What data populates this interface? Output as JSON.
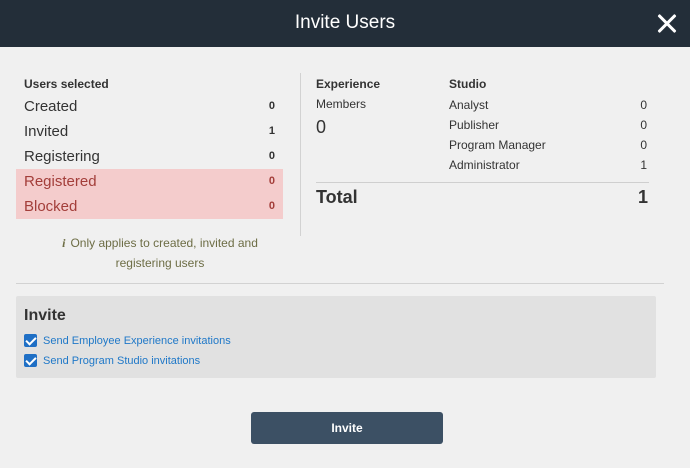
{
  "dialog": {
    "title": "Invite Users",
    "close_icon": "close-icon"
  },
  "users_selected": {
    "heading": "Users selected",
    "rows": [
      {
        "label": "Created",
        "count": "0"
      },
      {
        "label": "Invited",
        "count": "1"
      },
      {
        "label": "Registering",
        "count": "0"
      },
      {
        "label": "Registered",
        "count": "0"
      },
      {
        "label": "Blocked",
        "count": "0"
      }
    ],
    "note_icon": "info-icon",
    "note_glyph": "i",
    "note": "Only applies to created, invited and registering users",
    "warning_bg": "#f4cccc",
    "warning_text": "#a33e3a"
  },
  "experience": {
    "heading": "Experience",
    "label": "Members",
    "count": "0"
  },
  "studio": {
    "heading": "Studio",
    "rows": [
      {
        "label": "Analyst",
        "count": "0"
      },
      {
        "label": "Publisher",
        "count": "0"
      },
      {
        "label": "Program Manager",
        "count": "0"
      },
      {
        "label": "Administrator",
        "count": "1"
      }
    ]
  },
  "total": {
    "label": "Total",
    "value": "1"
  },
  "invite_section": {
    "heading": "Invite",
    "options": [
      {
        "label": "Send Employee Experience invitations",
        "checked": true
      },
      {
        "label": "Send Program Studio invitations",
        "checked": true
      }
    ],
    "checkbox_color": "#1f6fc5"
  },
  "invite_button": {
    "label": "Invite",
    "color": "#3c5064"
  },
  "header_color": "#232e39"
}
